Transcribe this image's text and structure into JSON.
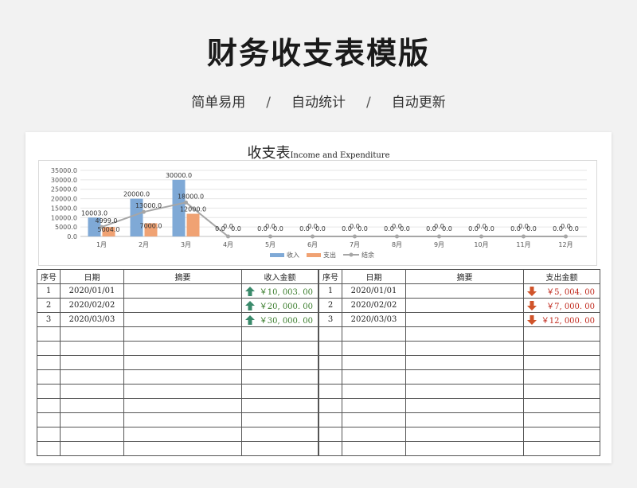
{
  "title": "财务收支表模版",
  "subtitle": {
    "items": [
      "简单易用",
      "自动统计",
      "自动更新"
    ],
    "separator": "/"
  },
  "sheet": {
    "title_cn": "收支表",
    "title_en": "Income and Expenditure"
  },
  "chart_data": {
    "type": "bar",
    "categories": [
      "1月",
      "2月",
      "3月",
      "4月",
      "5月",
      "6月",
      "7月",
      "8月",
      "9月",
      "10月",
      "11月",
      "12月"
    ],
    "series": [
      {
        "name": "收入",
        "type": "bar",
        "color": "#7fa9d6",
        "values": [
          10003,
          20000,
          30000,
          0,
          0,
          0,
          0,
          0,
          0,
          0,
          0,
          0
        ],
        "labels": [
          "10003.0",
          "20000.0",
          "30000.0",
          "0.0",
          "0.0",
          "0.0",
          "0.0",
          "0.0",
          "0.0",
          "0.0",
          "0.0",
          "0.0"
        ]
      },
      {
        "name": "支出",
        "type": "bar",
        "color": "#f0a273",
        "values": [
          5004,
          7000,
          12000,
          0,
          0,
          0,
          0,
          0,
          0,
          0,
          0,
          0
        ],
        "labels": [
          "5004.0",
          "7000.0",
          "12000.0",
          "0.0",
          "0.0",
          "0.0",
          "0.0",
          "0.0",
          "0.0",
          "0.0",
          "0.0",
          "0.0"
        ]
      },
      {
        "name": "结余",
        "type": "line",
        "color": "#a6a6a6",
        "values": [
          4999,
          13000,
          18000,
          0,
          0,
          0,
          0,
          0,
          0,
          0,
          0,
          0
        ],
        "labels": [
          "4999.0",
          "13000.0",
          "18000.0",
          "0.0",
          "0.0",
          "0.0",
          "0.0",
          "0.0",
          "0.0",
          "0.0",
          "0.0",
          "0.0"
        ]
      }
    ],
    "y_ticks": [
      "0.0",
      "5000.0",
      "10000.0",
      "15000.0",
      "20000.0",
      "25000.0",
      "30000.0",
      "35000.0"
    ],
    "ylim": [
      0,
      35000
    ],
    "grid": true,
    "legend_position": "bottom"
  },
  "income_table": {
    "headers": [
      "序号",
      "日期",
      "摘要",
      "收入金额"
    ],
    "rows": [
      {
        "index": "1",
        "date": "2020/01/01",
        "summary": "",
        "amount": "￥10, 003. 00"
      },
      {
        "index": "2",
        "date": "2020/02/02",
        "summary": "",
        "amount": "￥20, 000. 00"
      },
      {
        "index": "3",
        "date": "2020/03/03",
        "summary": "",
        "amount": "￥30, 000. 00"
      }
    ],
    "arrow_icon": "up-arrow-icon",
    "arrow_color": "#3a8a6b",
    "amount_color": "#3a7d2c"
  },
  "expense_table": {
    "headers": [
      "序号",
      "日期",
      "摘要",
      "支出金额"
    ],
    "rows": [
      {
        "index": "1",
        "date": "2020/01/01",
        "summary": "",
        "amount": "￥5, 004. 00"
      },
      {
        "index": "2",
        "date": "2020/02/02",
        "summary": "",
        "amount": "￥7, 000. 00"
      },
      {
        "index": "3",
        "date": "2020/03/03",
        "summary": "",
        "amount": "￥12, 000. 00"
      }
    ],
    "arrow_icon": "down-arrow-icon",
    "arrow_color": "#d0542a",
    "amount_color": "#c0281c"
  }
}
